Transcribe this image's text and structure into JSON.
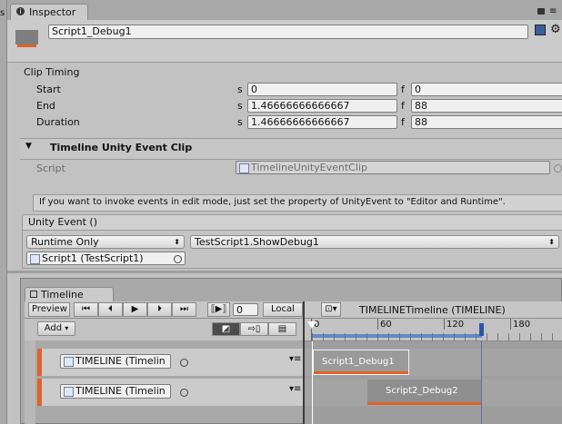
{
  "tab": {
    "title": "Inspector"
  },
  "header": {
    "object_name": "Script1_Debug1"
  },
  "clip_timing": {
    "title": "Clip Timing",
    "rows": [
      {
        "label": "Start",
        "s_label": "s",
        "s_value": "0",
        "f_label": "f",
        "f_value": "0"
      },
      {
        "label": "End",
        "s_label": "s",
        "s_value": "1.46666666666667",
        "f_label": "f",
        "f_value": "88"
      },
      {
        "label": "Duration",
        "s_label": "s",
        "s_value": "1.46666666666667",
        "f_label": "f",
        "f_value": "88"
      }
    ]
  },
  "component": {
    "title": "Timeline Unity Event Clip",
    "script_label": "Script",
    "script_value": "TimelineUnityEventClip",
    "help_text": "If you want to invoke events in edit mode, just set the property of UnityEvent to \"Editor and Runtime\"."
  },
  "unity_event": {
    "title": "Unity Event ()",
    "mode": "Runtime Only",
    "function": "TestScript1.ShowDebug1",
    "target": "Script1 (TestScript1)"
  },
  "timeline": {
    "tab_title": "Timeline",
    "preview_label": "Preview",
    "frame_value": "0",
    "local_label": "Local",
    "add_label": "Add",
    "asset_title": "TIMELINETimeline (TIMELINE)",
    "ruler_ticks": [
      "0",
      "60",
      "120",
      "180"
    ],
    "tracks": [
      {
        "name": "TIMELINE (Timelin"
      },
      {
        "name": "TIMELINE (Timelin"
      }
    ],
    "clips": [
      {
        "name": "Script1_Debug1"
      },
      {
        "name": "Script2_Debug2"
      }
    ]
  },
  "colors": {
    "accent_orange": "#e0612a",
    "selection_blue": "#3a6fc4",
    "clip_gray": "#8e8e8e"
  },
  "icons": [
    "info-icon",
    "lock-icon",
    "menu-icon",
    "gameobject-icon",
    "book-icon",
    "gear-icon",
    "foldout-triangle-icon",
    "object-picker-icon",
    "playhead-icon"
  ]
}
